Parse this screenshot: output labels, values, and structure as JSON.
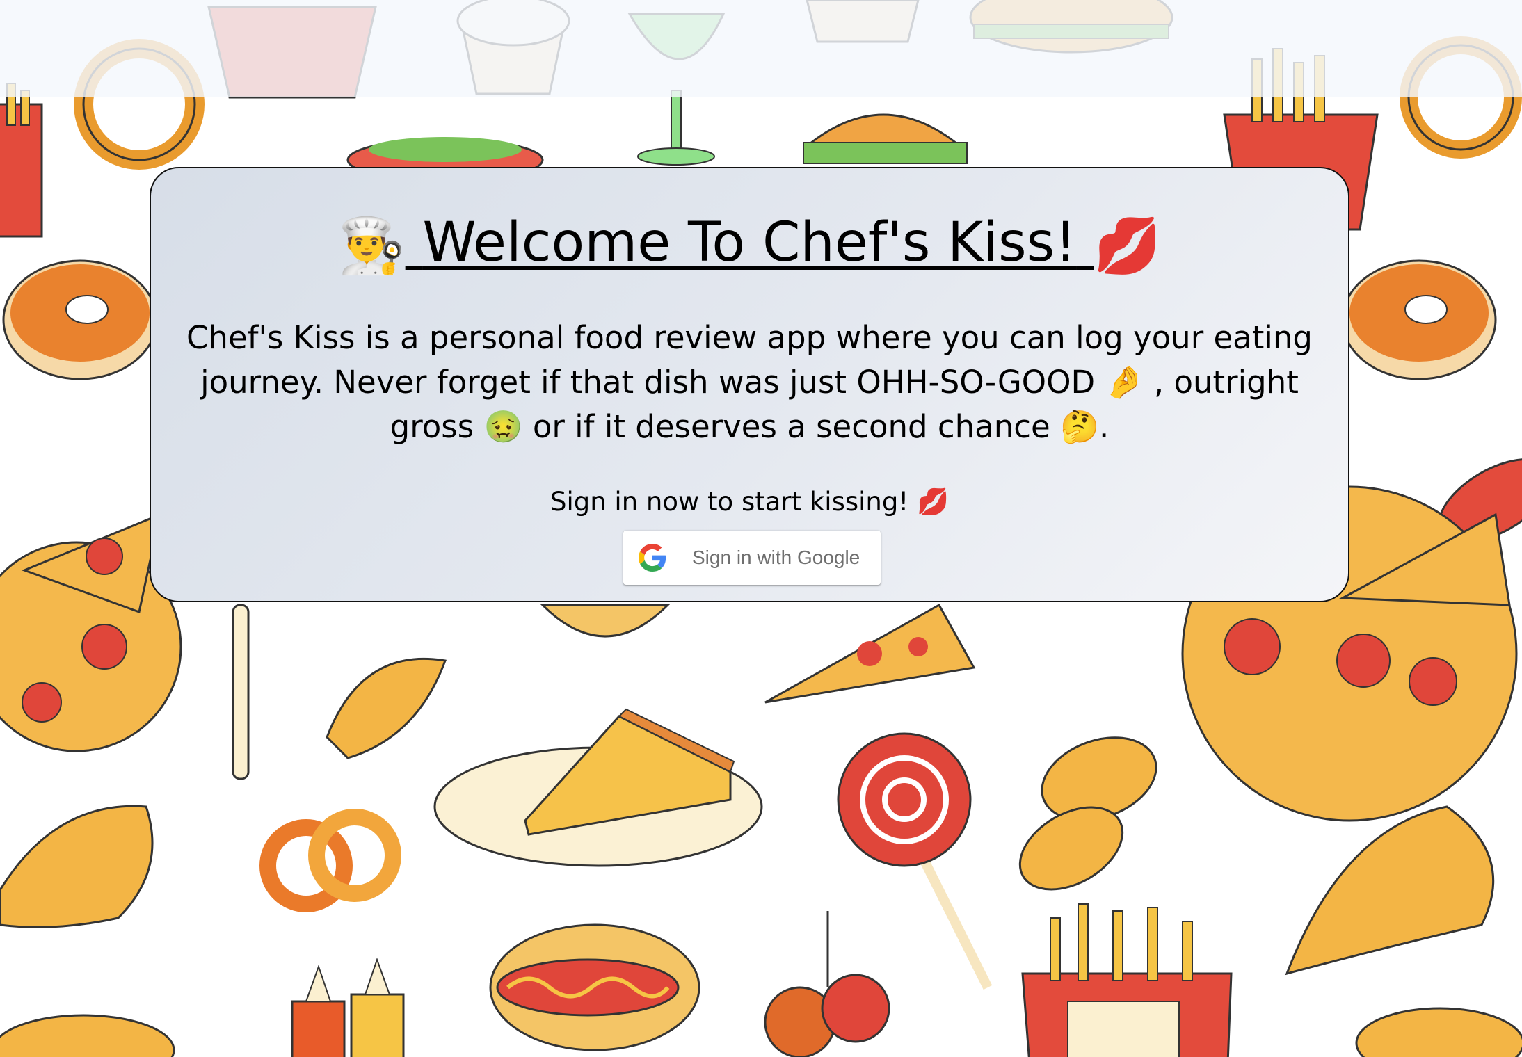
{
  "title": {
    "icon_left": "👨‍🍳",
    "text": "Welcome To Chef's Kiss!",
    "icon_right": "💋"
  },
  "description": {
    "part1": "Chef's Kiss is a personal food review app where you can log your eating journey. Never forget if that dish was just OHH-SO-GOOD",
    "emoji_good": "🤌",
    "part2": ", outright gross",
    "emoji_gross": "🤢",
    "part3": "or if it deserves a second chance",
    "emoji_think": "🤔",
    "part4": "."
  },
  "cta": {
    "text": "Sign in now to start kissing!",
    "emoji": "💋"
  },
  "google_button": {
    "label": "Sign in with Google",
    "icon": "google-g-logo"
  },
  "colors": {
    "card_gradient_start": "#d7dee8",
    "card_gradient_end": "#f4f5f8",
    "card_border": "#111111",
    "text": "#000000",
    "button_text": "#6f6f6f",
    "google_blue": "#4285F4",
    "google_red": "#EA4335",
    "google_yellow": "#FBBC05",
    "google_green": "#34A853"
  }
}
